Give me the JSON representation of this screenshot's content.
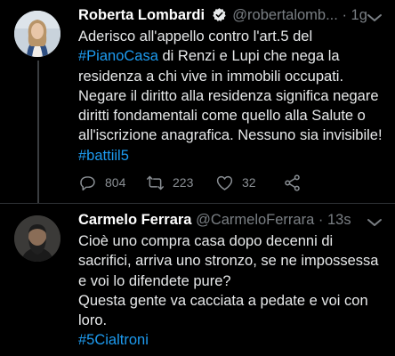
{
  "tweets": [
    {
      "name": "Roberta Lombardi",
      "handle": "@robertalomb...",
      "separator": "·",
      "time": "1g",
      "text": {
        "p1": "Aderisco all'appello contro l'art.5 del ",
        "tag1": "#PianoCasa",
        "p2": " di Renzi e Lupi che nega la residenza a chi vive in immobili occupati. Negare il diritto alla residenza significa negare diritti fondamentali come quello alla Salute o all'iscrizione anagrafica. Nessuno sia invisibile! ",
        "tag2": "#battiil5"
      },
      "replies": "804",
      "retweets": "223",
      "likes": "32"
    },
    {
      "name": "Carmelo Ferrara",
      "handle": "@CarmeloFerrara",
      "separator": "·",
      "time": "13s",
      "text": {
        "line1": "Cioè uno compra casa dopo decenni di sacrifici, arriva uno stronzo, se ne impossessa e voi lo difendete pure?",
        "line2": "Questa gente va cacciata a pedate e voi con loro.",
        "tag": "#5Cialtroni"
      }
    }
  ],
  "colors": {
    "background": "#000000",
    "hashtag": "#1d9bf0",
    "secondary_text": "#7a7f84",
    "verified_badge": "#e7e9ea"
  },
  "icons": {
    "verified": "verified-badge-icon",
    "more": "more-options-icon",
    "reply": "reply-icon",
    "retweet": "retweet-icon",
    "like": "heart-icon",
    "share": "share-icon"
  }
}
